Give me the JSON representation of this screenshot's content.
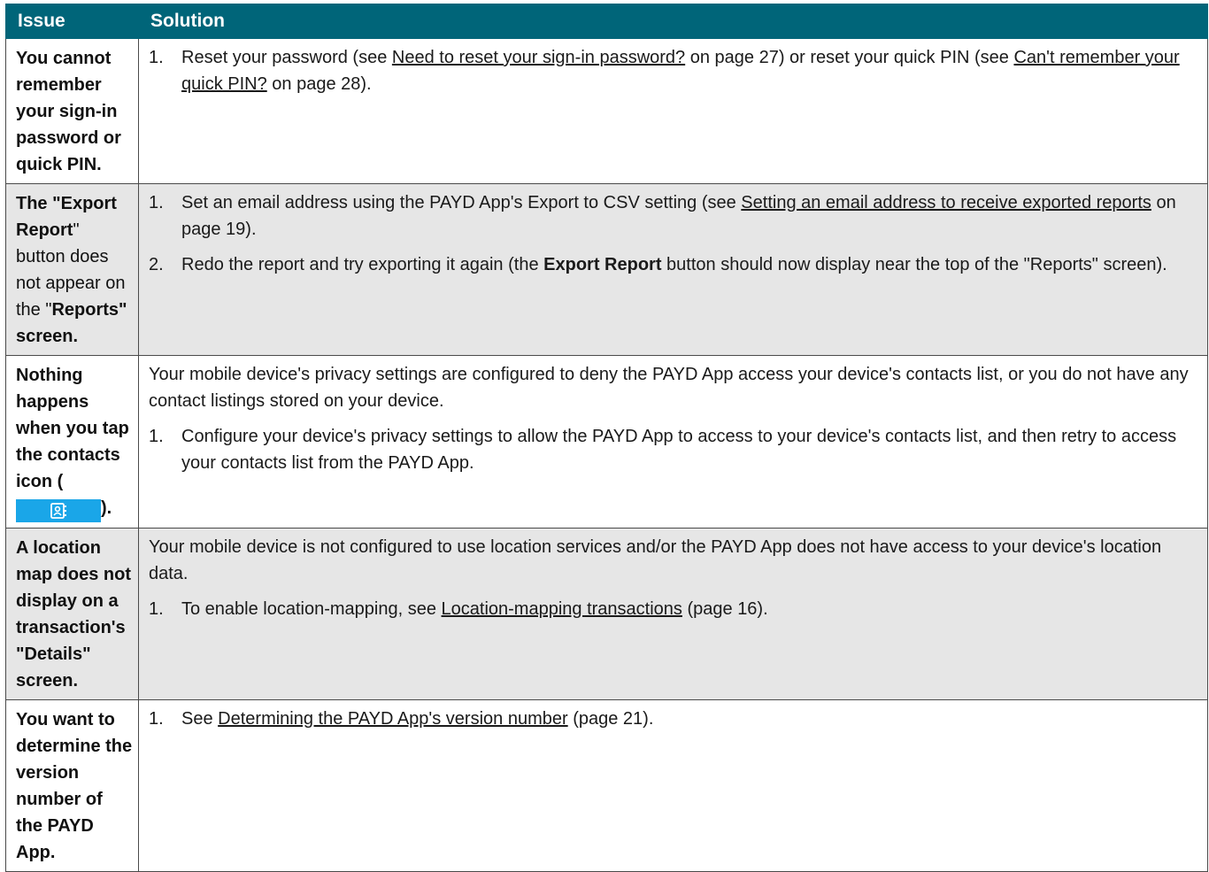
{
  "table": {
    "headers": {
      "issue": "Issue",
      "solution": "Solution"
    },
    "rows": [
      {
        "issue": "You cannot remember your sign-in password or quick PIN.",
        "steps": [
          {
            "num": "1.",
            "t1": "Reset your password (see ",
            "link1": "Need to reset your sign-in password?",
            "t2": " on page 27) or reset your quick PIN (see ",
            "link2": "Can't remember your quick PIN?",
            "t3": " on page 28)."
          }
        ]
      },
      {
        "issue_a": "The \"",
        "issue_b": "Export Report",
        "issue_c": "\" button does not appear on the \"",
        "issue_d": "Reports",
        "issue_e": "\" screen.",
        "steps": [
          {
            "num": "1.",
            "t1": "Set an email address using the PAYD App's Export to CSV setting (see ",
            "link1": "Setting an email address to receive exported reports",
            "t2": " on page 19)."
          },
          {
            "num": "2.",
            "t1": "Redo the report and try exporting it again (the ",
            "bold": "Export Report",
            "t2": " button should now display near the top of the \"Reports\" screen)."
          }
        ]
      },
      {
        "issue_a": "Nothing happens when you tap the contacts icon (",
        "issue_icon": "contacts-icon",
        "issue_b": ").",
        "intro": "Your mobile device's privacy settings are configured to deny the PAYD App access your device's contacts list, or you do not have any contact listings stored on your device.",
        "steps": [
          {
            "num": "1.",
            "t1": "Configure your device's privacy settings to allow the PAYD App to access to your device's contacts list, and then retry to access your contacts list from the PAYD App."
          }
        ]
      },
      {
        "issue_a": "A location map does not display on a transaction's \"",
        "issue_b": "Details",
        "issue_c": "\" screen.",
        "intro": "Your mobile device is not configured to use location services and/or the PAYD App does not have access to your device's location data.",
        "steps": [
          {
            "num": "1.",
            "t1": "To enable location-mapping, see ",
            "link1": "Location-mapping transactions",
            "t2": " (page 16)."
          }
        ]
      },
      {
        "issue": "You want to determine the version number of the PAYD App.",
        "steps": [
          {
            "num": "1.",
            "t1": "See ",
            "link1": "Determining the PAYD App's version number",
            "t2": " (page 21)."
          }
        ]
      }
    ]
  },
  "colors": {
    "header_bg": "#006579",
    "shade_bg": "#e6e6e6",
    "icon_bg": "#1aa6e8"
  }
}
